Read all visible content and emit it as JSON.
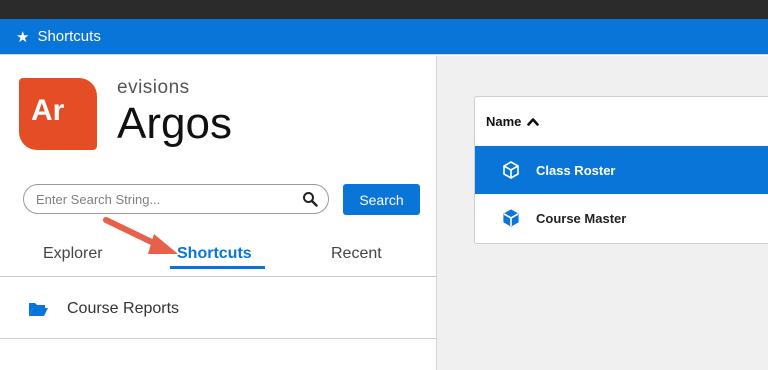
{
  "titlebar": {
    "title": "Shortcuts",
    "icon": "star-icon"
  },
  "brand": {
    "logo_text": "Ar",
    "vendor": "evisions",
    "product": "Argos"
  },
  "search": {
    "placeholder": "Enter Search String...",
    "value": "",
    "button_label": "Search"
  },
  "tabs": [
    {
      "label": "Explorer",
      "active": false
    },
    {
      "label": "Shortcuts",
      "active": true
    },
    {
      "label": "Recent",
      "active": false
    }
  ],
  "tree": {
    "items": [
      {
        "label": "Course Reports",
        "icon": "folder-open-icon"
      }
    ]
  },
  "grid": {
    "header": {
      "label": "Name",
      "sort": "ascending"
    },
    "rows": [
      {
        "label": "Class Roster",
        "selected": true,
        "icon": "report-cube-icon"
      },
      {
        "label": "Course Master",
        "selected": false,
        "icon": "report-cube-icon"
      }
    ]
  },
  "colors": {
    "accent": "#0a75d8",
    "logo": "#e44d26",
    "annotation_arrow": "#e8604a"
  }
}
